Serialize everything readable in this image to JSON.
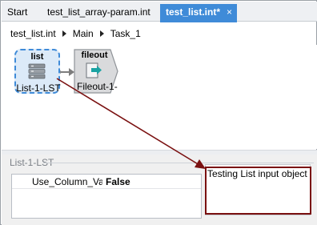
{
  "tabs": [
    {
      "label": "Start",
      "active": false
    },
    {
      "label": "test_list_array-param.int",
      "active": false
    },
    {
      "label": "test_list.int*",
      "active": true,
      "close_icon": "×"
    }
  ],
  "breadcrumb": [
    "test_list.int",
    "Main",
    "Task_1"
  ],
  "canvas": {
    "nodes": [
      {
        "type_label": "list",
        "label": "List-1-LST",
        "icon": "list-icon",
        "selected": true
      },
      {
        "type_label": "fileout",
        "label": "Fileout-1-",
        "icon": "fileout-icon",
        "selected": false
      }
    ]
  },
  "properties": {
    "title": "List-1-LST",
    "rows": [
      {
        "name": "Use_Column_Value",
        "value": "False"
      }
    ],
    "description": "Testing List input object"
  },
  "colors": {
    "accent": "#3f8bd8",
    "annotation": "#7a1010",
    "node_fill": "#dceaf8"
  }
}
